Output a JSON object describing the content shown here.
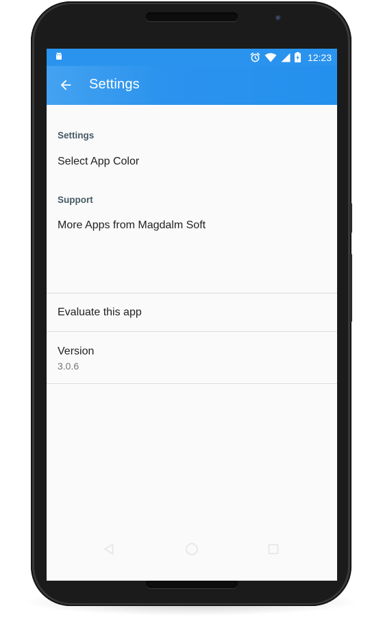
{
  "status_bar": {
    "time": "12:23",
    "icons": [
      "android-icon",
      "alarm-icon",
      "wifi-icon",
      "signal-icon",
      "battery-charging-icon"
    ]
  },
  "app_bar": {
    "title": "Settings",
    "back_icon": "arrow-back-icon"
  },
  "sections": [
    {
      "header": "Settings",
      "items": [
        {
          "title": "Select App Color"
        }
      ]
    },
    {
      "header": "Support",
      "items": [
        {
          "title": "More Apps from Magdalm Soft"
        },
        {
          "title": "Evaluate this app"
        },
        {
          "title": "Version",
          "summary": "3.0.6"
        }
      ]
    }
  ],
  "nav_bar": {
    "icons": [
      "back-triangle-icon",
      "home-circle-icon",
      "recents-square-icon"
    ]
  },
  "colors": {
    "status_bar": "#2a93ed",
    "app_bar": "#2b93ee",
    "background": "#fafafa",
    "section_header": "#455a64",
    "item_title": "#212121",
    "item_summary": "#757575",
    "divider": "#dcdcdc"
  }
}
